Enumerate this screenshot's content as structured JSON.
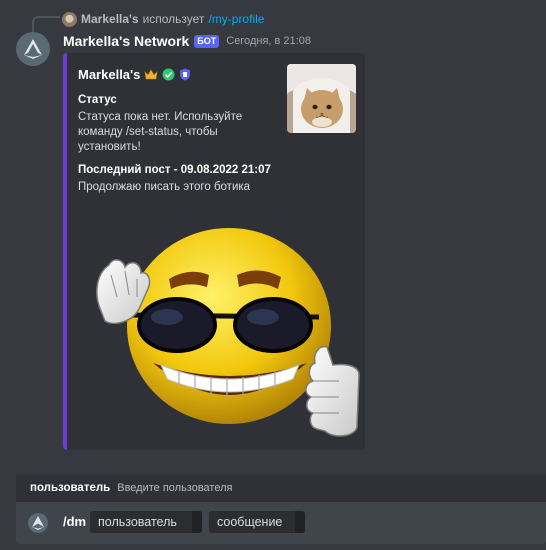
{
  "reply": {
    "user": "Markella's",
    "action": "использует",
    "command": "/my-profile"
  },
  "message": {
    "author": "Markella's Network",
    "bot_badge": "БОТ",
    "timestamp": "Сегодня, в 21:08"
  },
  "embed": {
    "accent_color": "#6a3dda",
    "title": "Markella's",
    "title_icons": [
      "crown-icon",
      "verified-check-icon",
      "shield-icon"
    ],
    "fields": [
      {
        "name": "Статус",
        "value": "Статуса пока нет. Используйте команду /set-status, чтобы установить!"
      },
      {
        "name": "Последний пост - 09.08.2022 21:07",
        "value": "Продолжаю писать этого ботика"
      }
    ],
    "thumbnail": "cat-photo",
    "image": "sunglasses-smiley-thumbs-up"
  },
  "command_options": {
    "option_name": "пользователь",
    "option_hint": "Введите пользователя"
  },
  "input": {
    "command": "/dm",
    "params": [
      "пользователь",
      "сообщение"
    ]
  }
}
